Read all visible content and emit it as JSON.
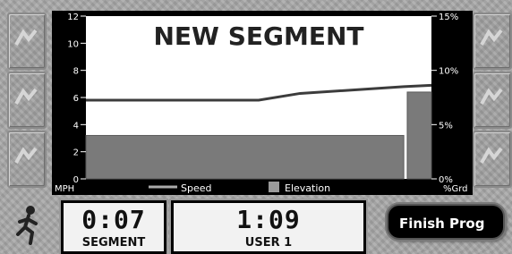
{
  "chart": {
    "title": "NEW SEGMENT",
    "left_axis_unit": "MPH",
    "right_axis_unit": "%Grd",
    "left_ticks": [
      "12",
      "10",
      "8",
      "6",
      "4",
      "2",
      "0"
    ],
    "right_ticks": [
      "15%",
      "10%",
      "5%",
      "0%"
    ],
    "legend": {
      "speed": "Speed",
      "elevation": "Elevation"
    }
  },
  "chart_data": {
    "type": "bar",
    "title": "NEW SEGMENT",
    "xlabel": "",
    "ylabel": "MPH",
    "y2label": "%Grd",
    "ylim": [
      0,
      12
    ],
    "y2lim": [
      0,
      15
    ],
    "series": [
      {
        "name": "Elevation",
        "type": "bar",
        "axis": "y2",
        "segments": [
          {
            "start": 0,
            "end": 0.92,
            "value": 4
          },
          {
            "start": 0.93,
            "end": 1.0,
            "value": 8
          }
        ]
      },
      {
        "name": "Speed",
        "type": "line",
        "axis": "y",
        "x": [
          0,
          0.5,
          0.62,
          0.92,
          1.0
        ],
        "y": [
          5.8,
          5.8,
          6.3,
          6.8,
          6.9
        ]
      }
    ],
    "grid": false,
    "legend_position": "bottom"
  },
  "stats": {
    "segment": {
      "value": "0:07",
      "label": "SEGMENT"
    },
    "user": {
      "value": "1:09",
      "label": "USER 1"
    }
  },
  "finish_button": {
    "label": "Finish Prog"
  },
  "colors": {
    "chart_bg": "#000000",
    "plot_bg": "#ffffff",
    "bar": "#7a7a7a",
    "line": "#3c3c3c",
    "panel": "#f2f2f2"
  },
  "icons": {
    "runner": "runner-icon",
    "tile": "logo-tile-icon"
  }
}
